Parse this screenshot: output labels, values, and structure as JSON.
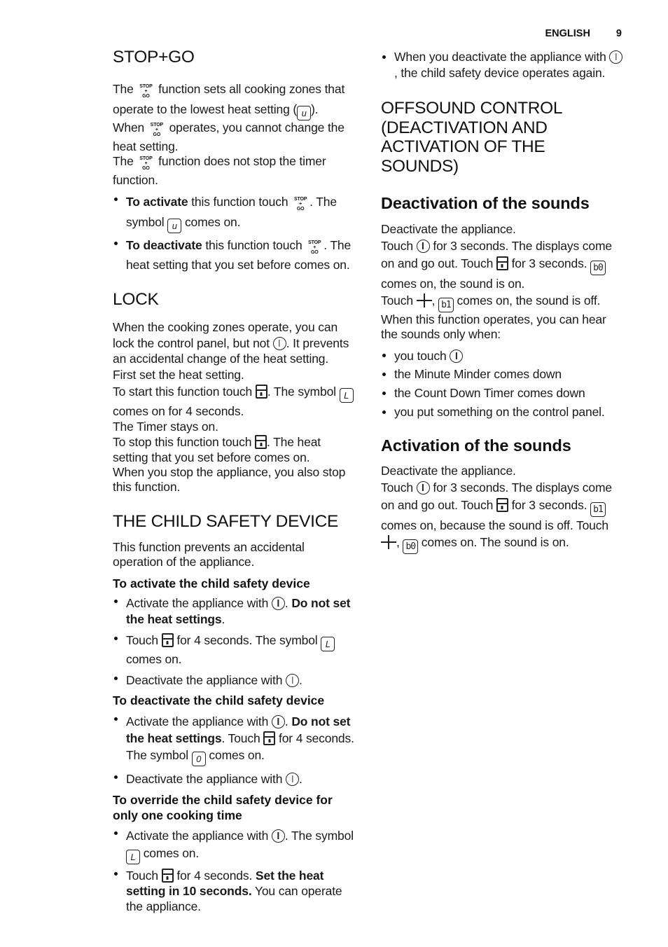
{
  "header": {
    "language": "ENGLISH",
    "page_number": "9"
  },
  "icons": {
    "stopgo": {
      "top": "STOP",
      "mid": "+",
      "bottom": "GO"
    },
    "display_u": "u",
    "display_L": "L",
    "display_0": "0",
    "display_b0": "b0",
    "display_b1": "b1"
  },
  "stopgo_section": {
    "title": "STOP+GO",
    "p1_a": "The",
    "p1_b": "function sets all cooking zones that operate to the lowest heat setting (",
    "p1_c": ").",
    "p2_a": "When",
    "p2_b": "operates, you cannot change the heat setting.",
    "p3_a": "The",
    "p3_b": "function does not stop the timer function.",
    "bullets": [
      {
        "bold": "To activate",
        "a": " this function touch ",
        "b": ". The symbol ",
        "c": " comes on."
      },
      {
        "bold": "To deactivate",
        "a": " this function touch ",
        "b": ". The heat setting that you set before comes on."
      }
    ]
  },
  "lock_section": {
    "title": "LOCK",
    "p1_a": "When the cooking zones operate, you can lock the control panel, but not ",
    "p1_b": ". It prevents an accidental change of the heat setting.",
    "p2": "First set the heat setting.",
    "p3_a": "To start this function touch ",
    "p3_b": ". The symbol ",
    "p3_c": " comes on for 4 seconds.",
    "p4": "The Timer stays on.",
    "p5_a": "To stop this function touch ",
    "p5_b": ". The heat setting that you set before comes on.",
    "p6": "When you stop the appliance, you also stop this function."
  },
  "child_safety_section": {
    "title": "THE CHILD SAFETY DEVICE",
    "intro": "This function prevents an accidental operation of the appliance.",
    "activate": {
      "heading": "To activate the child safety device",
      "b1_a": "Activate the appliance with ",
      "b1_b": ". ",
      "b1_bold": "Do not set the heat settings",
      "b1_c": ".",
      "b2_a": "Touch ",
      "b2_b": " for 4 seconds. The symbol ",
      "b2_c": " comes on.",
      "b3_a": "Deactivate the appliance with ",
      "b3_b": "."
    },
    "deactivate": {
      "heading": "To deactivate the child safety device",
      "b1_a": "Activate the appliance with ",
      "b1_b": ". ",
      "b1_bold": "Do not set the heat settings",
      "b1_c": ". Touch ",
      "b1_d": " for 4 seconds. The symbol ",
      "b1_e": " comes on.",
      "b2_a": "Deactivate the appliance with ",
      "b2_b": "."
    },
    "override": {
      "heading": "To override the child safety device for only one cooking time",
      "b1_a": "Activate the appliance with ",
      "b1_b": ". The symbol ",
      "b1_c": " comes on.",
      "b2_a": "Touch ",
      "b2_b": " for 4 seconds. ",
      "b2_bold": "Set the heat setting in 10 seconds.",
      "b2_c": " You can operate the appliance.",
      "b3_a": "When you deactivate the appliance with ",
      "b3_b": ", the child safety device operates again."
    }
  },
  "offsound_section": {
    "title": "OFFSOUND CONTROL (DEACTIVATION AND ACTIVATION OF THE SOUNDS)",
    "deactivation": {
      "heading": "Deactivation of the sounds",
      "p1": "Deactivate the appliance.",
      "p2_a": "Touch ",
      "p2_b": " for 3 seconds. The displays come on and go out. Touch ",
      "p2_c": " for 3 seconds. ",
      "p2_d": " comes on, the sound is on.",
      "p3_a": "Touch ",
      "p3_b": ", ",
      "p3_c": " comes on, the sound is off.",
      "p4": "When this function operates, you can hear the sounds only when:",
      "bullets": [
        "you touch",
        "the Minute Minder comes down",
        "the Count Down Timer comes down",
        "you put something on the control panel."
      ]
    },
    "activation": {
      "heading": "Activation of the sounds",
      "p1": "Deactivate the appliance.",
      "p2_a": "Touch ",
      "p2_b": " for 3 seconds. The displays come on and go out. Touch ",
      "p2_c": " for 3 seconds. ",
      "p2_d": " comes on, because the sound is off. Touch ",
      "p2_e": ", ",
      "p2_f": " comes on. The sound is on."
    }
  }
}
